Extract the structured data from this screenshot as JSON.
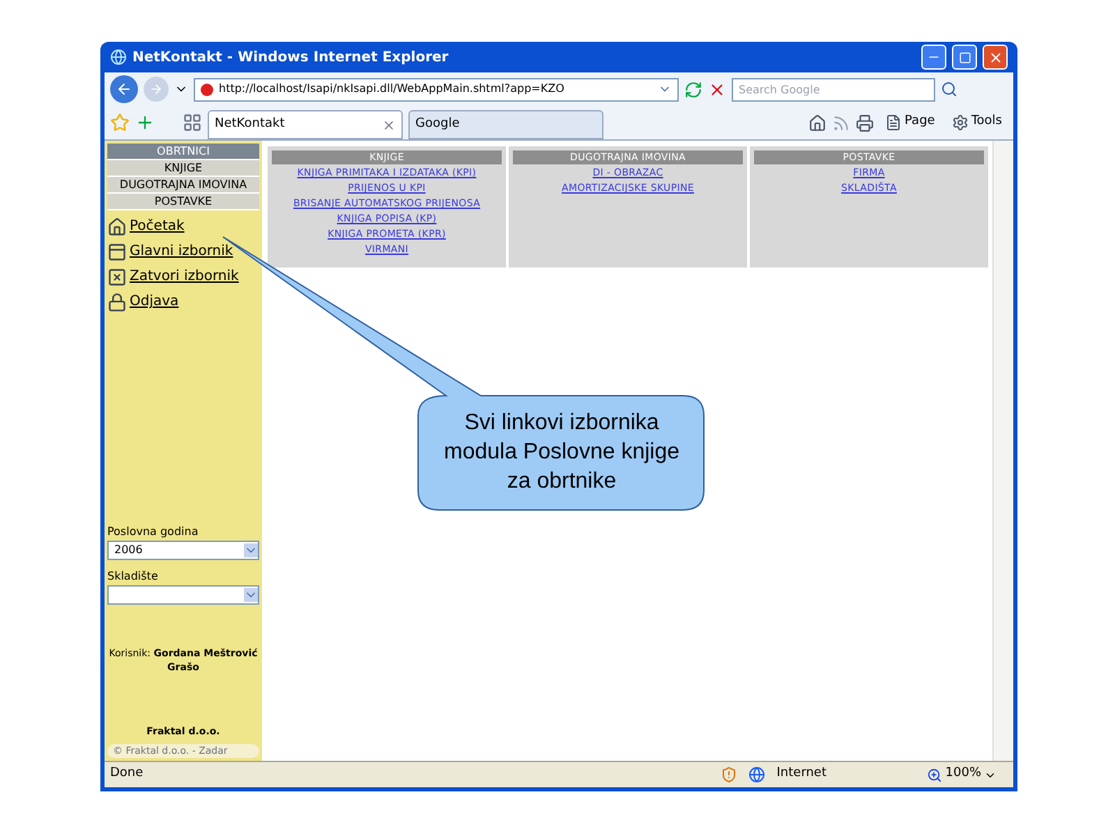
{
  "window": {
    "title": "NetKontakt - Windows Internet Explorer"
  },
  "address_bar": {
    "url": "http://localhost/Isapi/nkIsapi.dll/WebAppMain.shtml?app=KZO",
    "search_placeholder": "Search Google"
  },
  "tabs": [
    {
      "label": "NetKontakt",
      "selected": true
    },
    {
      "label": "Google",
      "selected": false
    }
  ],
  "toolbar": [
    "Page",
    "Tools"
  ],
  "sidebar": {
    "menu": [
      {
        "label": "OBRTNICI",
        "kind": "header"
      },
      {
        "label": "KNJIGE",
        "kind": "item"
      },
      {
        "label": "DUGOTRAJNA IMOVINA",
        "kind": "item"
      },
      {
        "label": "POSTAVKE",
        "kind": "item"
      }
    ],
    "links": [
      {
        "label": "Početak",
        "kind": "home"
      },
      {
        "label": "Glavni izbornik",
        "kind": "menu"
      },
      {
        "label": "Zatvori izbornik",
        "kind": "close"
      },
      {
        "label": "Odjava",
        "kind": "lock"
      }
    ],
    "year": {
      "label": "Poslovna godina",
      "value": "2006"
    },
    "warehouse": {
      "label": "Skladište"
    },
    "user": "Korisnik: **Gordana Meštrović Grašo**",
    "company": "Fraktal d.o.o.",
    "copyright": "© Fraktal d.o.o. - Zadar"
  },
  "panels": [
    {
      "title": "KNJIGE",
      "links": [
        "KNJIGA PRIMITAKA I IZDATAKA (KPI)",
        "PRIJENOS U KPI",
        "BRISANJE AUTOMATSKOG PRIJENOSA",
        "KNJIGA POPISA (KP)",
        "KNJIGA PROMETA (KPR)",
        "VIRMANI"
      ]
    },
    {
      "title": "DUGOTRAJNA IMOVINA",
      "links": [
        "DI - OBRAZAC",
        "AMORTIZACIJSKE SKUPINE"
      ]
    },
    {
      "title": "POSTAVKE",
      "links": [
        "FIRMA",
        "SKLADIŠTA"
      ]
    }
  ],
  "callout": "Svi linkovi izbornika modula Poslovne knjige za obrtnike",
  "status_bar": {
    "status": "Done",
    "zone": "Internet",
    "zoom": "100%"
  }
}
